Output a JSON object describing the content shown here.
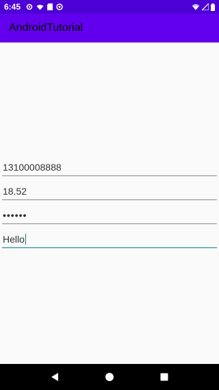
{
  "status_bar": {
    "time": "6:45",
    "icons_left": [
      "settings-icon",
      "wifi-icon",
      "sd-card-icon",
      "sync-icon"
    ],
    "icons_right": [
      "wifi-icon",
      "signal-icon",
      "battery-icon"
    ]
  },
  "app_bar": {
    "title": "AndroidTutorial",
    "background": "#6200ee"
  },
  "form": {
    "phone_value": "13100008888",
    "decimal_value": "18.52",
    "password_value": "••••••",
    "text_value": "Hello"
  },
  "nav": {
    "back": "back-icon",
    "home": "home-icon",
    "recents": "recents-icon"
  },
  "colors": {
    "status_bar": "#4d00d4",
    "accent": "#008577"
  }
}
